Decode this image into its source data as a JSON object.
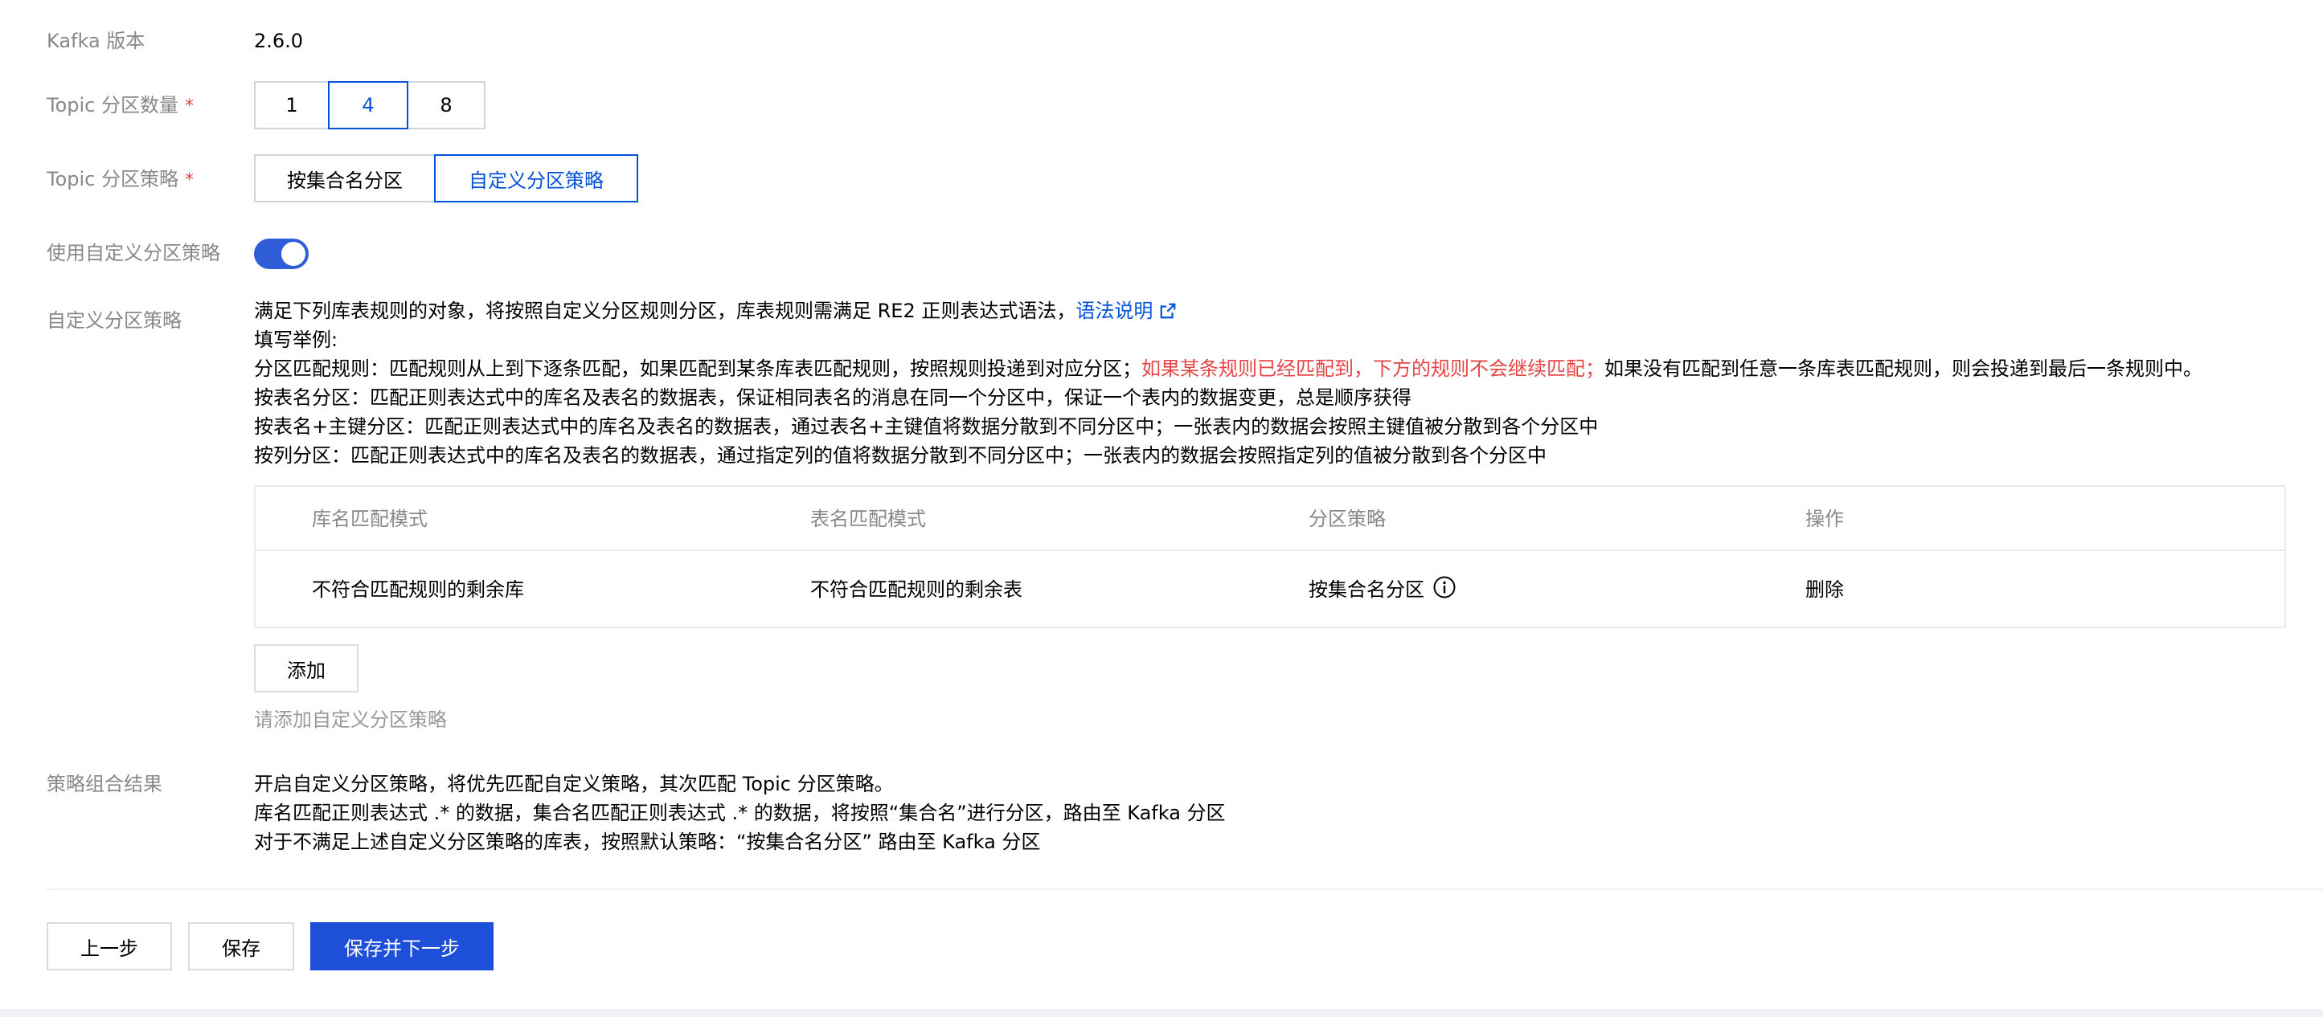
{
  "form": {
    "kafka_version": {
      "label": "Kafka 版本",
      "value": "2.6.0"
    },
    "partition_count": {
      "label": "Topic 分区数量",
      "required_mark": "*",
      "options": [
        "1",
        "4",
        "8"
      ],
      "selected": "4"
    },
    "partition_strategy": {
      "label": "Topic 分区策略",
      "required_mark": "*",
      "options": [
        "按集合名分区",
        "自定义分区策略"
      ],
      "selected": "自定义分区策略"
    },
    "custom_toggle": {
      "label": "使用自定义分区策略",
      "enabled": true
    },
    "custom_strategy": {
      "label": "自定义分区策略",
      "intro": "满足下列库表规则的对象，将按照自定义分区规则分区，库表规则需满足 RE2 正则表达式语法，",
      "syntax_link": "语法说明",
      "example_title": "填写举例:",
      "rule_prefix": "分区匹配规则：匹配规则从上到下逐条匹配，如果匹配到某条库表匹配规则，按照规则投递到对应分区；",
      "rule_warning": "如果某条规则已经匹配到，下方的规则不会继续匹配；",
      "rule_suffix": "如果没有匹配到任意一条库表匹配规则，则会投递到最后一条规则中。",
      "by_table": "按表名分区：匹配正则表达式中的库名及表名的数据表，保证相同表名的消息在同一个分区中，保证一个表内的数据变更，总是顺序获得",
      "by_table_pk": "按表名+主键分区：匹配正则表达式中的库名及表名的数据表，通过表名+主键值将数据分散到不同分区中；一张表内的数据会按照主键值被分散到各个分区中",
      "by_column": "按列分区：匹配正则表达式中的库名及表名的数据表，通过指定列的值将数据分散到不同分区中；一张表内的数据会按照指定列的值被分散到各个分区中"
    },
    "rules_table": {
      "columns": [
        "库名匹配模式",
        "表名匹配模式",
        "分区策略",
        "操作"
      ],
      "rows": [
        {
          "db_pattern": "不符合匹配规则的剩余库",
          "table_pattern": "不符合匹配规则的剩余表",
          "strategy": "按集合名分区",
          "action": "删除"
        }
      ]
    },
    "add_button": "添加",
    "add_hint": "请添加自定义分区策略",
    "result": {
      "label": "策略组合结果",
      "line1": "开启自定义分区策略，将优先匹配自定义策略，其次匹配 Topic 分区策略。",
      "line2": "库名匹配正则表达式 .* 的数据，集合名匹配正则表达式 .* 的数据，将按照“集合名”进行分区，路由至 Kafka 分区",
      "line3": "对于不满足上述自定义分区策略的库表，按照默认策略：“按集合名分区” 路由至 Kafka 分区"
    }
  },
  "footer": {
    "prev": "上一步",
    "save": "保存",
    "save_next": "保存并下一步"
  },
  "colors": {
    "primary": "#0052d9",
    "warning": "#e54545",
    "label": "#888888"
  }
}
